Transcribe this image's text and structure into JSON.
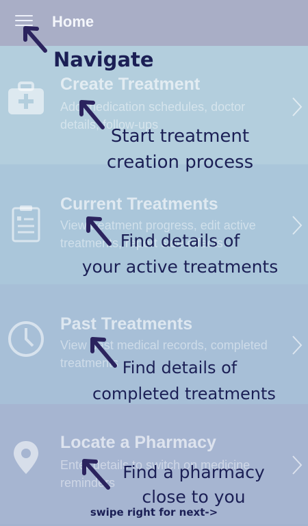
{
  "appbar": {
    "title": "Home",
    "menu_icon": "hamburger-menu-icon"
  },
  "rows": [
    {
      "title": "Create Treatment",
      "desc": "Add medication schedules, doctor details, follow-ups",
      "icon": "first-aid-kit-icon"
    },
    {
      "title": "Current Treatments",
      "desc": "View treatment progress, edit active treatments, report side effects",
      "icon": "clipboard-icon"
    },
    {
      "title": "Past Treatments",
      "desc": "View past medical records, completed treatments",
      "icon": "clock-icon"
    },
    {
      "title": "Locate a Pharmacy",
      "desc": "Enter details to switch on medicine reminders",
      "icon": "location-pin-icon"
    }
  ],
  "annotations": {
    "navigate": "Navigate",
    "create_line1": "Start treatment",
    "create_line2": "creation process",
    "current_line1": "Find details of",
    "current_line2": "your active treatments",
    "past_line1": "Find details of",
    "past_line2": "completed treatments",
    "pharmacy_line1": "Find a pharmacy",
    "pharmacy_line2": "close to you",
    "swipe": "swipe right for next->"
  },
  "colors": {
    "row1_bg": "#b3cedd",
    "row2_bg": "#aac6da",
    "row3_bg": "#a7bfd7",
    "row4_bg": "#a6b5d1",
    "annotation": "#1b1f55"
  }
}
